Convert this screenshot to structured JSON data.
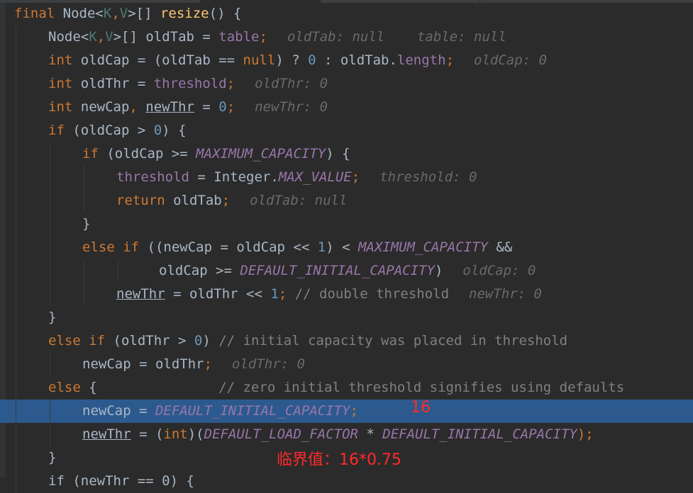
{
  "editor": {
    "lines": [
      {
        "indent": 0,
        "tokens": [
          {
            "t": "final ",
            "c": "kw"
          },
          {
            "t": "Node",
            "c": "id"
          },
          {
            "t": "<",
            "c": "id"
          },
          {
            "t": "K",
            "c": "type"
          },
          {
            "t": ",",
            "c": "kw"
          },
          {
            "t": "V",
            "c": "type"
          },
          {
            "t": ">[] ",
            "c": "id"
          },
          {
            "t": "resize",
            "c": "fn"
          },
          {
            "t": "() {",
            "c": "id"
          }
        ]
      },
      {
        "indent": 1,
        "tokens": [
          {
            "t": "Node",
            "c": "id"
          },
          {
            "t": "<",
            "c": "id"
          },
          {
            "t": "K",
            "c": "type"
          },
          {
            "t": ",",
            "c": "kw"
          },
          {
            "t": "V",
            "c": "type"
          },
          {
            "t": ">[] oldTab = ",
            "c": "id"
          },
          {
            "t": "table",
            "c": "field"
          },
          {
            "t": ";",
            "c": "kw"
          },
          {
            "t": "oldTab: null    table: null",
            "c": "hint"
          }
        ]
      },
      {
        "indent": 1,
        "tokens": [
          {
            "t": "int ",
            "c": "kw"
          },
          {
            "t": "oldCap = (oldTab == ",
            "c": "id"
          },
          {
            "t": "null",
            "c": "kw"
          },
          {
            "t": ") ? ",
            "c": "id"
          },
          {
            "t": "0",
            "c": "num"
          },
          {
            "t": " : oldTab.",
            "c": "id"
          },
          {
            "t": "length",
            "c": "field"
          },
          {
            "t": ";",
            "c": "kw"
          },
          {
            "t": "oldCap: 0",
            "c": "hint"
          }
        ]
      },
      {
        "indent": 1,
        "tokens": [
          {
            "t": "int ",
            "c": "kw"
          },
          {
            "t": "oldThr = ",
            "c": "id"
          },
          {
            "t": "threshold",
            "c": "field"
          },
          {
            "t": ";",
            "c": "kw"
          },
          {
            "t": "oldThr: 0",
            "c": "hint"
          }
        ]
      },
      {
        "indent": 1,
        "tokens": [
          {
            "t": "int ",
            "c": "kw"
          },
          {
            "t": "newCap",
            "c": "id"
          },
          {
            "t": ", ",
            "c": "kw"
          },
          {
            "t": "newThr",
            "c": "id ul"
          },
          {
            "t": " = ",
            "c": "id"
          },
          {
            "t": "0",
            "c": "num"
          },
          {
            "t": ";",
            "c": "kw"
          },
          {
            "t": "newThr: 0",
            "c": "hint"
          }
        ]
      },
      {
        "indent": 1,
        "tokens": [
          {
            "t": "if ",
            "c": "kw"
          },
          {
            "t": "(oldCap > ",
            "c": "id"
          },
          {
            "t": "0",
            "c": "num"
          },
          {
            "t": ") {",
            "c": "id"
          }
        ]
      },
      {
        "indent": 2,
        "tokens": [
          {
            "t": "if ",
            "c": "kw"
          },
          {
            "t": "(oldCap >= ",
            "c": "id"
          },
          {
            "t": "MAXIMUM_CAPACITY",
            "c": "const"
          },
          {
            "t": ") {",
            "c": "id"
          }
        ]
      },
      {
        "indent": 3,
        "tokens": [
          {
            "t": "threshold",
            "c": "field"
          },
          {
            "t": " = Integer.",
            "c": "id"
          },
          {
            "t": "MAX_VALUE",
            "c": "const"
          },
          {
            "t": ";",
            "c": "kw"
          },
          {
            "t": "threshold: 0",
            "c": "hint"
          }
        ]
      },
      {
        "indent": 3,
        "tokens": [
          {
            "t": "return ",
            "c": "kw"
          },
          {
            "t": "oldTab",
            "c": "id"
          },
          {
            "t": ";",
            "c": "kw"
          },
          {
            "t": "oldTab: null",
            "c": "hint"
          }
        ]
      },
      {
        "indent": 2,
        "tokens": [
          {
            "t": "}",
            "c": "id"
          }
        ]
      },
      {
        "indent": 2,
        "tokens": [
          {
            "t": "else if ",
            "c": "kw"
          },
          {
            "t": "((newCap = oldCap << ",
            "c": "id"
          },
          {
            "t": "1",
            "c": "num"
          },
          {
            "t": ") < ",
            "c": "id"
          },
          {
            "t": "MAXIMUM_CAPACITY",
            "c": "const"
          },
          {
            "t": " &&",
            "c": "id"
          }
        ]
      },
      {
        "indent": 4.25,
        "tokens": [
          {
            "t": "oldCap >= ",
            "c": "id"
          },
          {
            "t": "DEFAULT_INITIAL_CAPACITY",
            "c": "const"
          },
          {
            "t": ")",
            "c": "id"
          },
          {
            "t": "oldCap: 0",
            "c": "hint"
          }
        ]
      },
      {
        "indent": 3,
        "tokens": [
          {
            "t": "newThr",
            "c": "id ul"
          },
          {
            "t": " = oldThr << ",
            "c": "id"
          },
          {
            "t": "1",
            "c": "num"
          },
          {
            "t": "; ",
            "c": "kw"
          },
          {
            "t": "// double threshold",
            "c": "cmt"
          },
          {
            "t": "newThr: 0",
            "c": "hint"
          }
        ]
      },
      {
        "indent": 1,
        "tokens": [
          {
            "t": "}",
            "c": "id"
          }
        ]
      },
      {
        "indent": 1,
        "tokens": [
          {
            "t": "else if ",
            "c": "kw"
          },
          {
            "t": "(oldThr > ",
            "c": "id"
          },
          {
            "t": "0",
            "c": "num"
          },
          {
            "t": ") ",
            "c": "id"
          },
          {
            "t": "// initial capacity was placed in threshold",
            "c": "cmt"
          }
        ]
      },
      {
        "indent": 2,
        "tokens": [
          {
            "t": "newCap = oldThr",
            "c": "id"
          },
          {
            "t": ";",
            "c": "kw"
          },
          {
            "t": "oldThr: 0",
            "c": "hint"
          }
        ]
      },
      {
        "indent": 1,
        "tokens": [
          {
            "t": "else ",
            "c": "kw"
          },
          {
            "t": "{               ",
            "c": "id"
          },
          {
            "t": "// zero initial threshold signifies using defaults",
            "c": "cmt"
          }
        ]
      },
      {
        "indent": 2,
        "highlight": true,
        "tokens": [
          {
            "t": "newCap = ",
            "c": "id"
          },
          {
            "t": "DEFAULT_INITIAL_CAPACITY",
            "c": "const"
          },
          {
            "t": ";",
            "c": "kw"
          }
        ]
      },
      {
        "indent": 2,
        "tokens": [
          {
            "t": "newThr",
            "c": "id ul"
          },
          {
            "t": " = (",
            "c": "id"
          },
          {
            "t": "int",
            "c": "kw"
          },
          {
            "t": ")(",
            "c": "id"
          },
          {
            "t": "DEFAULT_LOAD_FACTOR",
            "c": "const"
          },
          {
            "t": " * ",
            "c": "id"
          },
          {
            "t": "DEFAULT_INITIAL_CAPACITY",
            "c": "const"
          },
          {
            "t": ");",
            "c": "kw"
          }
        ]
      },
      {
        "indent": 1,
        "tokens": [
          {
            "t": "}",
            "c": "id"
          }
        ]
      },
      {
        "indent": 1,
        "tokens": [
          {
            "t": "if (newThr == 0) {",
            "c": "id"
          }
        ]
      }
    ]
  },
  "annotations": {
    "capacity_note": "16",
    "threshold_note": "临界值：16*0.75"
  },
  "colors": {
    "background": "#2b2b2b",
    "highlight": "#2d5a8e",
    "annotation": "#ff2a2a"
  }
}
